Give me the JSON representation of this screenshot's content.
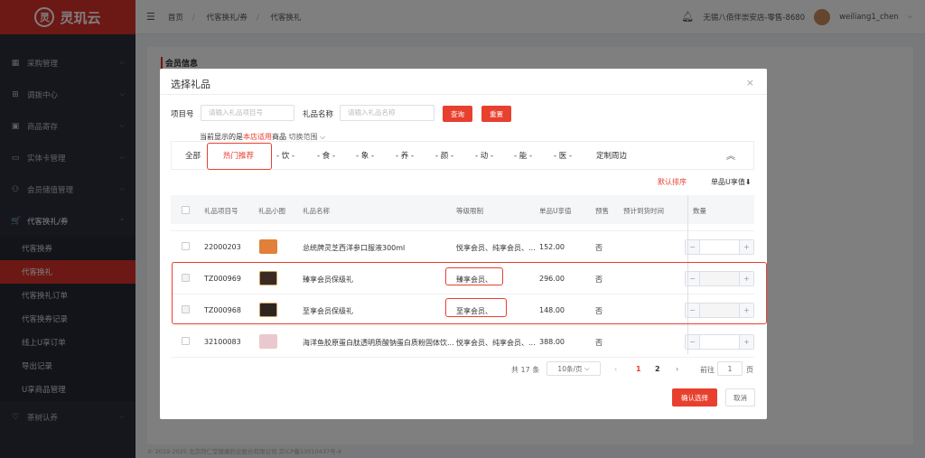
{
  "app": {
    "brand": "灵玑云",
    "logo_glyph": "灵"
  },
  "sidebar": {
    "items": [
      {
        "label": "采购管理",
        "icon": "calendar-icon"
      },
      {
        "label": "调拨中心",
        "icon": "grid-icon"
      },
      {
        "label": "商品寄存",
        "icon": "box-icon"
      },
      {
        "label": "实体卡管理",
        "icon": "card-icon"
      },
      {
        "label": "会员储值管理",
        "icon": "users-icon"
      },
      {
        "label": "代客换礼/券",
        "icon": "cart-icon"
      }
    ],
    "sub_items": [
      "代客换券",
      "代客换礼",
      "代客换礼订单",
      "代客换券记录",
      "线上U享订单",
      "导出记录",
      "U享商品管理"
    ],
    "bottom_item": "茶树认养"
  },
  "header": {
    "breadcrumb": [
      "首页",
      "代客换礼/券",
      "代客换礼"
    ],
    "store": "无锡八佰伴崇安店-零售-8680",
    "user": "weiliang1_chen"
  },
  "page": {
    "section_title": "会员信息",
    "footer": "© 2019-2025 北京同仁堂健康药业股份有限公司 京ICP备13010437号-4"
  },
  "dialog": {
    "title": "选择礼品",
    "close": "×",
    "filters": {
      "item_no_label": "项目号",
      "item_no_placeholder": "请输入礼品项目号",
      "name_label": "礼品名称",
      "name_placeholder": "请输入礼品名称",
      "query": "查询",
      "reset": "重置"
    },
    "scope": {
      "prefix": "当前显示的是",
      "highlight": "本店适用",
      "suffix": "商品",
      "switch": "切换范围 ⌵"
    },
    "categories": [
      "全部",
      "热门推荐",
      "- 饮 -",
      "- 食 -",
      "- 象 -",
      "- 养 -",
      "- 颜 -",
      "- 动 -",
      "- 能 -",
      "- 医 -",
      "定制周边"
    ],
    "sort": {
      "default": "默认排序",
      "price": "单品U享值⬇"
    },
    "columns": [
      "礼品项目号",
      "礼品小图",
      "礼品名称",
      "等级限制",
      "单品U享值",
      "预售",
      "预计到货时间",
      "数量"
    ],
    "rows": [
      {
        "id": "22000203",
        "name": "总统牌灵芝西洋参口服液300ml",
        "level": "悦享会员、纯享会员、...",
        "price": "152.00",
        "presale": "否",
        "thumb": "#e0803a",
        "disabled": false
      },
      {
        "id": "TZ000969",
        "name": "臻享会员保级礼",
        "level": "臻享会员、",
        "price": "296.00",
        "presale": "否",
        "thumb": "#3a2a22",
        "disabled": true
      },
      {
        "id": "TZ000968",
        "name": "至享会员保级礼",
        "level": "至享会员、",
        "price": "148.00",
        "presale": "否",
        "thumb": "#2e241f",
        "disabled": true
      },
      {
        "id": "32100083",
        "name": "海洋鱼胶原蛋白肽透明质酸钠蛋白质粉固体饮...",
        "level": "悦享会员、纯享会员、...",
        "price": "388.00",
        "presale": "否",
        "thumb": "#e9c9cf",
        "disabled": false
      }
    ],
    "pager": {
      "total": "共 17 条",
      "size": "10条/页",
      "pages": [
        "1",
        "2"
      ],
      "prev": "‹",
      "next": "›",
      "goto": "前往",
      "page_input": "1",
      "page_unit": "页"
    },
    "confirm": "确认选择",
    "cancel": "取消"
  },
  "colors": {
    "brand": "#d9302a",
    "accent": "#e8402f"
  }
}
